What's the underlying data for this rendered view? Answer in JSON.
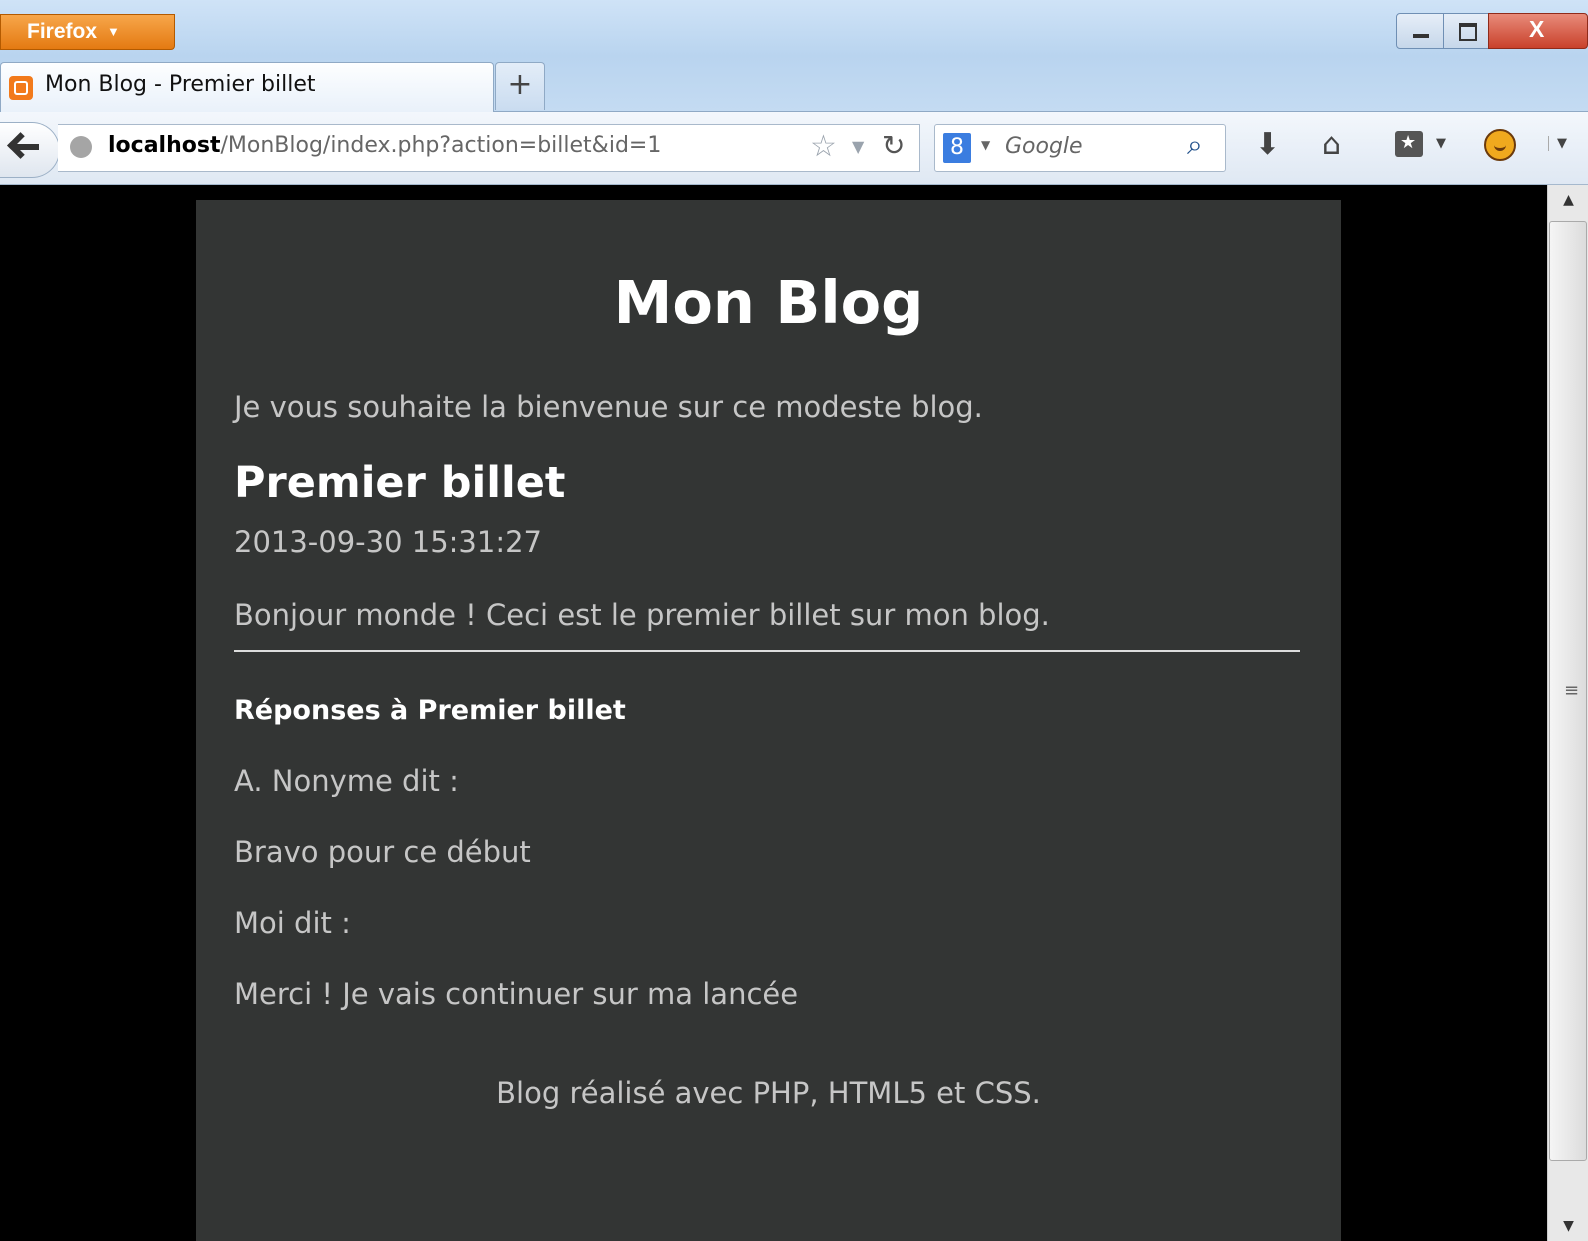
{
  "browser": {
    "menu_label": "Firefox",
    "close_label": "X",
    "tab": {
      "title": "Mon Blog - Premier billet"
    },
    "new_tab_label": "+",
    "url": {
      "host": "localhost",
      "path": "/MonBlog/index.php?action=billet&id=1"
    },
    "search": {
      "placeholder": "Google",
      "engine_icon": "8"
    }
  },
  "page": {
    "title": "Mon Blog",
    "intro": "Je vous souhaite la bienvenue sur ce modeste blog.",
    "post": {
      "title": "Premier billet",
      "date": "2013-09-30 15:31:27",
      "body": "Bonjour monde ! Ceci est le premier billet sur mon blog."
    },
    "replies_title": "Réponses à Premier billet",
    "comments": [
      {
        "author_line": "A. Nonyme dit :",
        "text": "Bravo pour ce début"
      },
      {
        "author_line": "Moi dit :",
        "text": "Merci ! Je vais continuer sur ma lancée"
      }
    ],
    "footer": "Blog réalisé avec PHP, HTML5 et CSS."
  },
  "icons": [
    "firefox-menu-arrow-icon",
    "minimize-icon",
    "maximize-icon",
    "close-icon",
    "favicon-icon",
    "new-tab-icon",
    "back-icon",
    "globe-icon",
    "bookmark-star-icon",
    "history-dropdown-icon",
    "reload-icon",
    "search-engine-icon",
    "search-icon",
    "download-icon",
    "home-icon",
    "bookmarks-icon",
    "addon-icon",
    "menu-icon"
  ]
}
